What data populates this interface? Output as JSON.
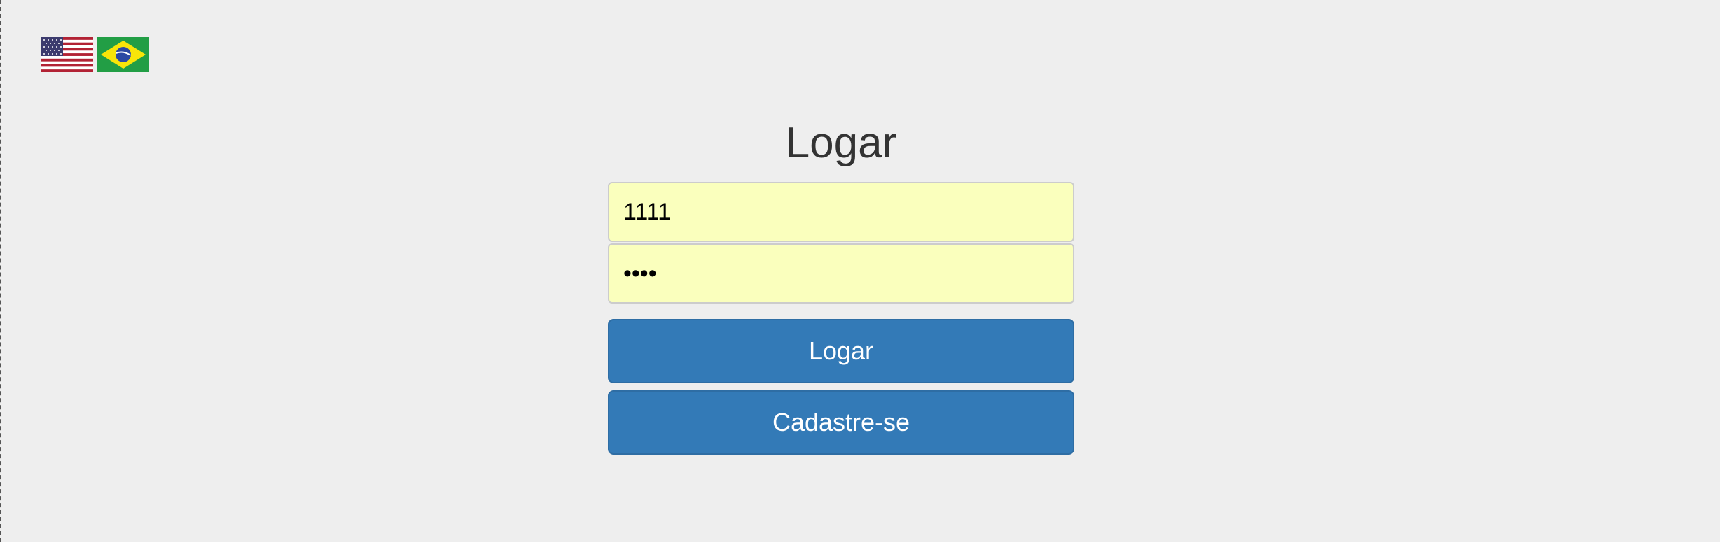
{
  "languages": [
    {
      "name": "English",
      "icon": "us-flag-icon"
    },
    {
      "name": "Português",
      "icon": "brazil-flag-icon"
    }
  ],
  "login": {
    "title": "Logar",
    "username_value": "1111",
    "password_value": "1111",
    "login_button": "Logar",
    "register_button": "Cadastre-se"
  },
  "colors": {
    "background": "#eeeeee",
    "input_autofill": "#faffbd",
    "button_primary": "#337ab7",
    "title_text": "#333333"
  }
}
